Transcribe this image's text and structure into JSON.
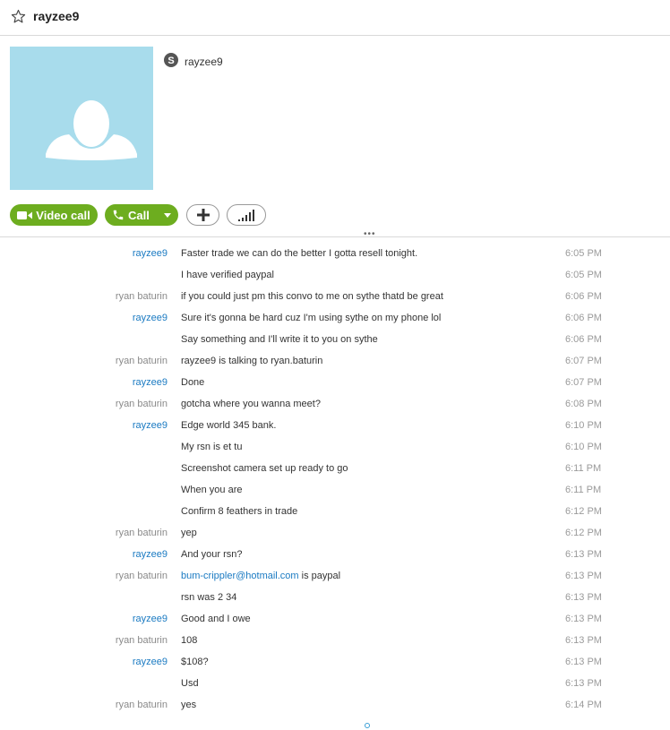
{
  "header": {
    "title": "rayzee9"
  },
  "profile": {
    "skype_name": "rayzee9"
  },
  "actions": {
    "video_call_label": "Video call",
    "call_label": "Call"
  },
  "colors": {
    "accent_green": "#6dad1f",
    "link_blue": "#1a7ac2",
    "avatar_bg": "#a8dcec"
  },
  "messages": [
    {
      "sender": "rayzee9",
      "text": "Faster trade we can do the better I gotta resell tonight.",
      "time": "6:05 PM"
    },
    {
      "sender": "",
      "text": "I have verified paypal",
      "time": "6:05 PM"
    },
    {
      "sender": "ryan baturin",
      "text": "if you could just pm this convo to me on sythe thatd be great",
      "time": "6:06 PM"
    },
    {
      "sender": "rayzee9",
      "text": "Sure it's gonna be hard cuz I'm using sythe on my phone lol",
      "time": "6:06 PM"
    },
    {
      "sender": "",
      "text": "Say something and I'll write it to you on sythe",
      "time": "6:06 PM"
    },
    {
      "sender": "ryan baturin",
      "text": "rayzee9 is talking to ryan.baturin",
      "time": "6:07 PM"
    },
    {
      "sender": "rayzee9",
      "text": "Done",
      "time": "6:07 PM"
    },
    {
      "sender": "ryan baturin",
      "text": "gotcha where you wanna meet?",
      "time": "6:08 PM"
    },
    {
      "sender": "rayzee9",
      "text": "Edge world 345 bank.",
      "time": "6:10 PM"
    },
    {
      "sender": "",
      "text": "My rsn is et tu",
      "time": "6:10 PM"
    },
    {
      "sender": "",
      "text": "Screenshot camera set up ready to go",
      "time": "6:11 PM"
    },
    {
      "sender": "",
      "text": "When you are",
      "time": "6:11 PM"
    },
    {
      "sender": "",
      "text": "Confirm 8 feathers in trade",
      "time": "6:12 PM"
    },
    {
      "sender": "ryan baturin",
      "text": "yep",
      "time": "6:12 PM"
    },
    {
      "sender": "rayzee9",
      "text": "And your rsn?",
      "time": "6:13 PM"
    },
    {
      "sender": "ryan baturin",
      "link": "bum-crippler@hotmail.com",
      "text": " is paypal",
      "time": "6:13 PM"
    },
    {
      "sender": "",
      "text": "rsn was 2 34",
      "time": "6:13 PM"
    },
    {
      "sender": "rayzee9",
      "text": "Good and I owe",
      "time": "6:13 PM"
    },
    {
      "sender": "ryan baturin",
      "text": "108",
      "time": "6:13 PM"
    },
    {
      "sender": "rayzee9",
      "text": "$108?",
      "time": "6:13 PM"
    },
    {
      "sender": "",
      "text": "Usd",
      "time": "6:13 PM"
    },
    {
      "sender": "ryan baturin",
      "text": "yes",
      "time": "6:14 PM"
    }
  ]
}
